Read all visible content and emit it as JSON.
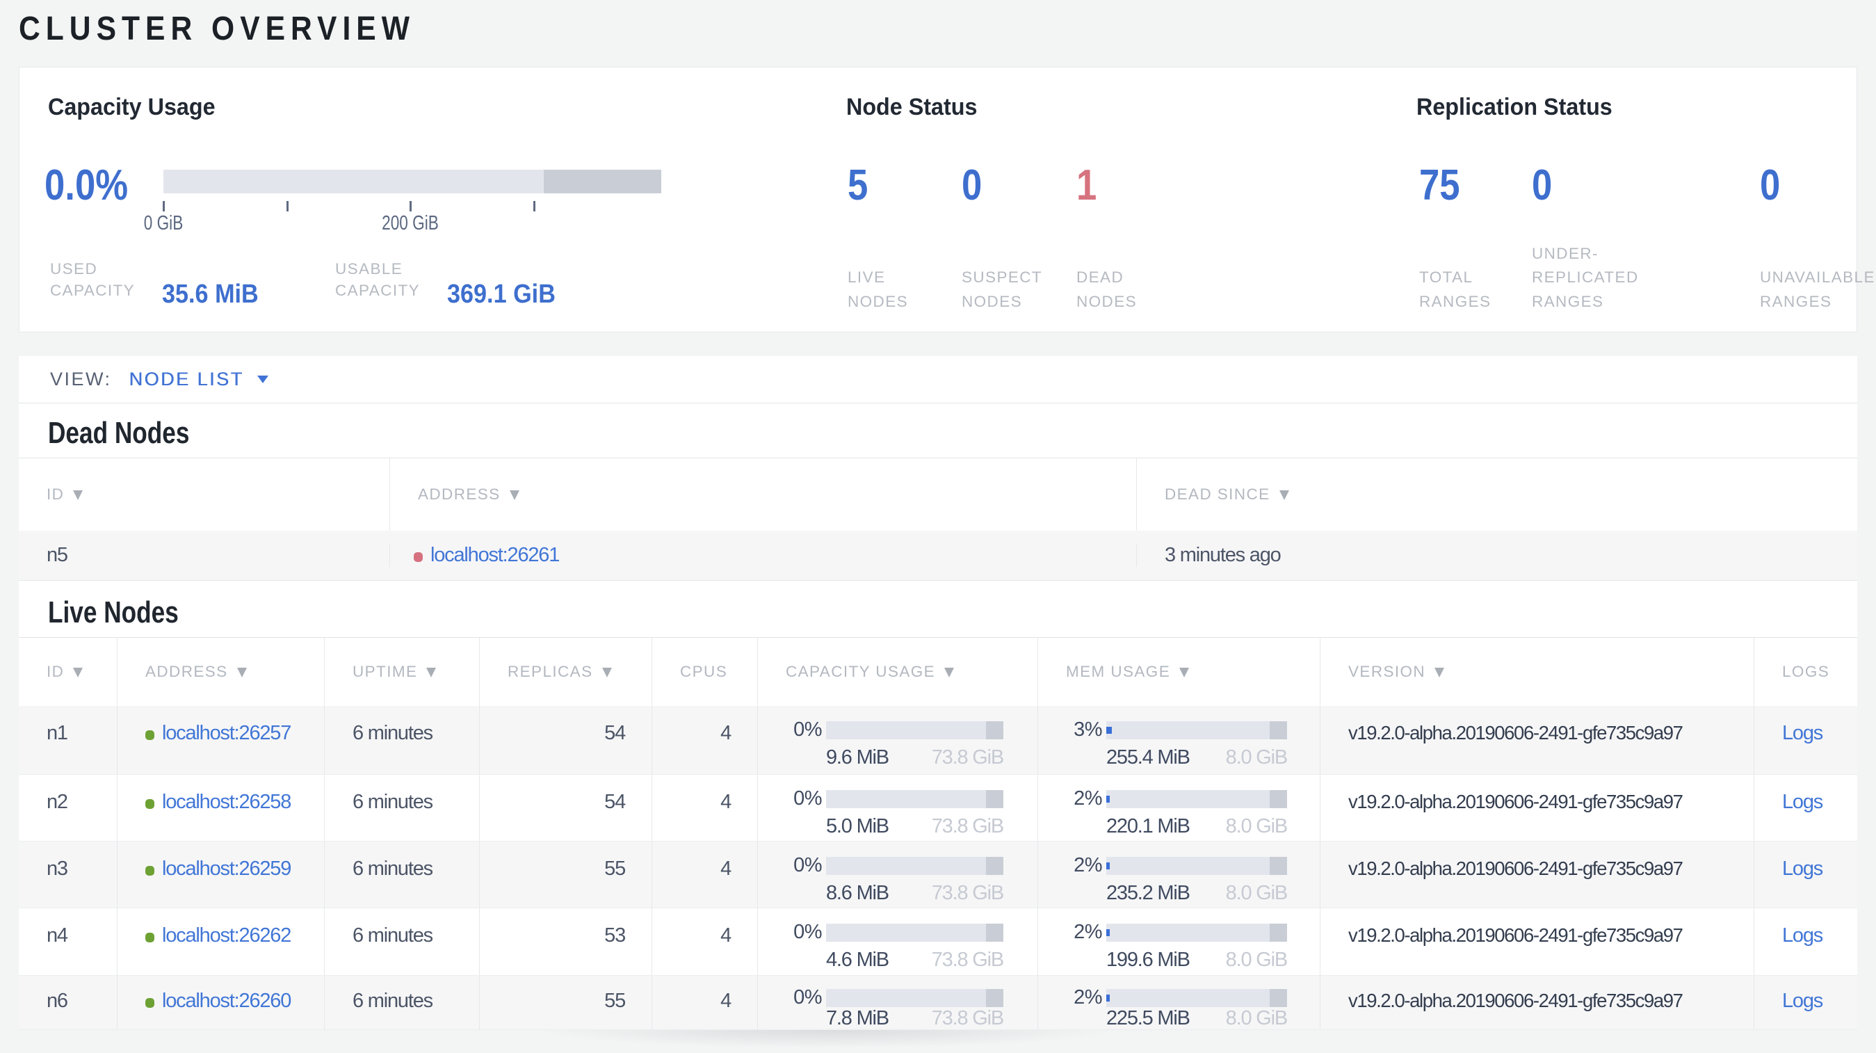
{
  "page_title": "CLUSTER OVERVIEW",
  "colors": {
    "accent_blue": "#4173d4",
    "number_blue": "#3e6fce",
    "danger_red": "#d6737f",
    "live_green": "#6ea133",
    "bar_bg": "#e2e5ec",
    "bar_dark": "#c9cdd6",
    "bar_fill": "#3a6fd8"
  },
  "overview": {
    "capacity": {
      "title": "Capacity Usage",
      "percent": "0.0%",
      "tick_labels": [
        "0 GiB",
        "200 GiB"
      ],
      "stats": [
        {
          "label_lines": [
            "USED",
            "CAPACITY"
          ],
          "value": "35.6 MiB"
        },
        {
          "label_lines": [
            "USABLE",
            "CAPACITY"
          ],
          "value": "369.1 GiB"
        }
      ]
    },
    "node_status": {
      "title": "Node Status",
      "items": [
        {
          "value": "5",
          "label_lines": [
            "LIVE",
            "NODES"
          ],
          "tone": "blue"
        },
        {
          "value": "0",
          "label_lines": [
            "SUSPECT",
            "NODES"
          ],
          "tone": "blue"
        },
        {
          "value": "1",
          "label_lines": [
            "DEAD",
            "NODES"
          ],
          "tone": "red"
        }
      ]
    },
    "replication": {
      "title": "Replication Status",
      "items": [
        {
          "value": "75",
          "label_lines": [
            "TOTAL",
            "RANGES"
          ],
          "tone": "blue"
        },
        {
          "value": "0",
          "label_lines": [
            "UNDER-",
            "REPLICATED",
            "RANGES"
          ],
          "tone": "blue"
        },
        {
          "value": "0",
          "label_lines": [
            "UNAVAILABLE",
            "RANGES"
          ],
          "tone": "blue"
        }
      ]
    }
  },
  "view_bar": {
    "label": "VIEW:",
    "selected": "NODE LIST"
  },
  "dead_nodes": {
    "title": "Dead Nodes",
    "columns": [
      {
        "label": "ID",
        "sort": true
      },
      {
        "label": "ADDRESS",
        "sort": true
      },
      {
        "label": "DEAD SINCE",
        "sort": true
      }
    ],
    "rows": [
      {
        "id": "n5",
        "address": "localhost:26261",
        "dead_since": "3 minutes ago"
      }
    ]
  },
  "live_nodes": {
    "title": "Live Nodes",
    "columns": [
      {
        "label": "ID",
        "sort": true
      },
      {
        "label": "ADDRESS",
        "sort": true
      },
      {
        "label": "UPTIME",
        "sort": true
      },
      {
        "label": "REPLICAS",
        "sort": true
      },
      {
        "label": "CPUS",
        "sort": false
      },
      {
        "label": "CAPACITY USAGE",
        "sort": true
      },
      {
        "label": "MEM USAGE",
        "sort": true
      },
      {
        "label": "VERSION",
        "sort": true
      },
      {
        "label": "LOGS",
        "sort": false
      }
    ],
    "rows": [
      {
        "id": "n1",
        "address": "localhost:26257",
        "uptime": "6 minutes",
        "replicas": "54",
        "cpus": "4",
        "cap_pct": "0%",
        "cap_used": "9.6 MiB",
        "cap_total": "73.8 GiB",
        "cap_fill": 0,
        "mem_pct": "3%",
        "mem_used": "255.4 MiB",
        "mem_total": "8.0 GiB",
        "mem_fill": 3,
        "version": "v19.2.0-alpha.20190606-2491-gfe735c9a97",
        "logs": "Logs"
      },
      {
        "id": "n2",
        "address": "localhost:26258",
        "uptime": "6 minutes",
        "replicas": "54",
        "cpus": "4",
        "cap_pct": "0%",
        "cap_used": "5.0 MiB",
        "cap_total": "73.8 GiB",
        "cap_fill": 0,
        "mem_pct": "2%",
        "mem_used": "220.1 MiB",
        "mem_total": "8.0 GiB",
        "mem_fill": 2,
        "version": "v19.2.0-alpha.20190606-2491-gfe735c9a97",
        "logs": "Logs"
      },
      {
        "id": "n3",
        "address": "localhost:26259",
        "uptime": "6 minutes",
        "replicas": "55",
        "cpus": "4",
        "cap_pct": "0%",
        "cap_used": "8.6 MiB",
        "cap_total": "73.8 GiB",
        "cap_fill": 0,
        "mem_pct": "2%",
        "mem_used": "235.2 MiB",
        "mem_total": "8.0 GiB",
        "mem_fill": 2,
        "version": "v19.2.0-alpha.20190606-2491-gfe735c9a97",
        "logs": "Logs"
      },
      {
        "id": "n4",
        "address": "localhost:26262",
        "uptime": "6 minutes",
        "replicas": "53",
        "cpus": "4",
        "cap_pct": "0%",
        "cap_used": "4.6 MiB",
        "cap_total": "73.8 GiB",
        "cap_fill": 0,
        "mem_pct": "2%",
        "mem_used": "199.6 MiB",
        "mem_total": "8.0 GiB",
        "mem_fill": 2,
        "version": "v19.2.0-alpha.20190606-2491-gfe735c9a97",
        "logs": "Logs"
      },
      {
        "id": "n6",
        "address": "localhost:26260",
        "uptime": "6 minutes",
        "replicas": "55",
        "cpus": "4",
        "cap_pct": "0%",
        "cap_used": "7.8 MiB",
        "cap_total": "73.8 GiB",
        "cap_fill": 0,
        "mem_pct": "2%",
        "mem_used": "225.5 MiB",
        "mem_total": "8.0 GiB",
        "mem_fill": 2,
        "version": "v19.2.0-alpha.20190606-2491-gfe735c9a97",
        "logs": "Logs"
      }
    ]
  }
}
